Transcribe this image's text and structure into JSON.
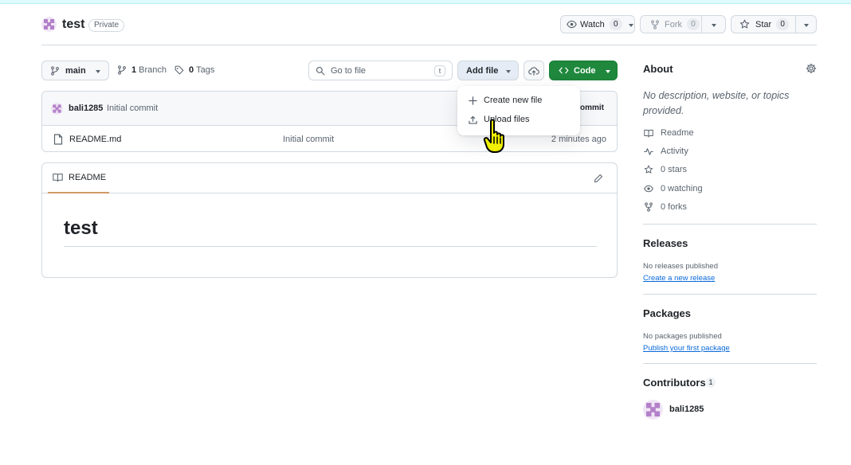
{
  "repo": {
    "name": "test",
    "visibility": "Private"
  },
  "header_actions": {
    "watch_label": "Watch",
    "watch_count": "0",
    "fork_label": "Fork",
    "fork_count": "0",
    "star_label": "Star",
    "star_count": "0"
  },
  "toolbar": {
    "branch": "main",
    "branches_count": "1",
    "branches_label": "Branch",
    "tags_count": "0",
    "tags_label": "Tags",
    "goto_placeholder": "Go to file",
    "goto_shortcut": "t",
    "add_file_label": "Add file",
    "code_label": "Code"
  },
  "add_file_menu": {
    "items": [
      "Create new file",
      "Upload files"
    ]
  },
  "commit_header": {
    "user": "bali1285",
    "message": "Initial commit",
    "right_label": "ommit"
  },
  "files": [
    {
      "name": "README.md",
      "commit": "Initial commit",
      "time": "2 minutes ago"
    }
  ],
  "readme": {
    "tab_label": "README",
    "heading": "test"
  },
  "sidebar": {
    "about_title": "About",
    "about_description": "No description, website, or topics provided.",
    "links": [
      "Readme",
      "Activity",
      "0 stars",
      "0 watching",
      "0 forks"
    ],
    "releases_title": "Releases",
    "releases_empty": "No releases published",
    "releases_link": "Create a new release",
    "packages_title": "Packages",
    "packages_empty": "No packages published",
    "packages_link": "Publish your first package",
    "contributors_title": "Contributors",
    "contributors_count": "1",
    "contributor_name": "bali1285"
  },
  "colors": {
    "primary_green": "#1f883d",
    "accent_blue": "#0969da",
    "readme_underline": "#d19a66",
    "cursor_yellow": "#f0f000"
  }
}
